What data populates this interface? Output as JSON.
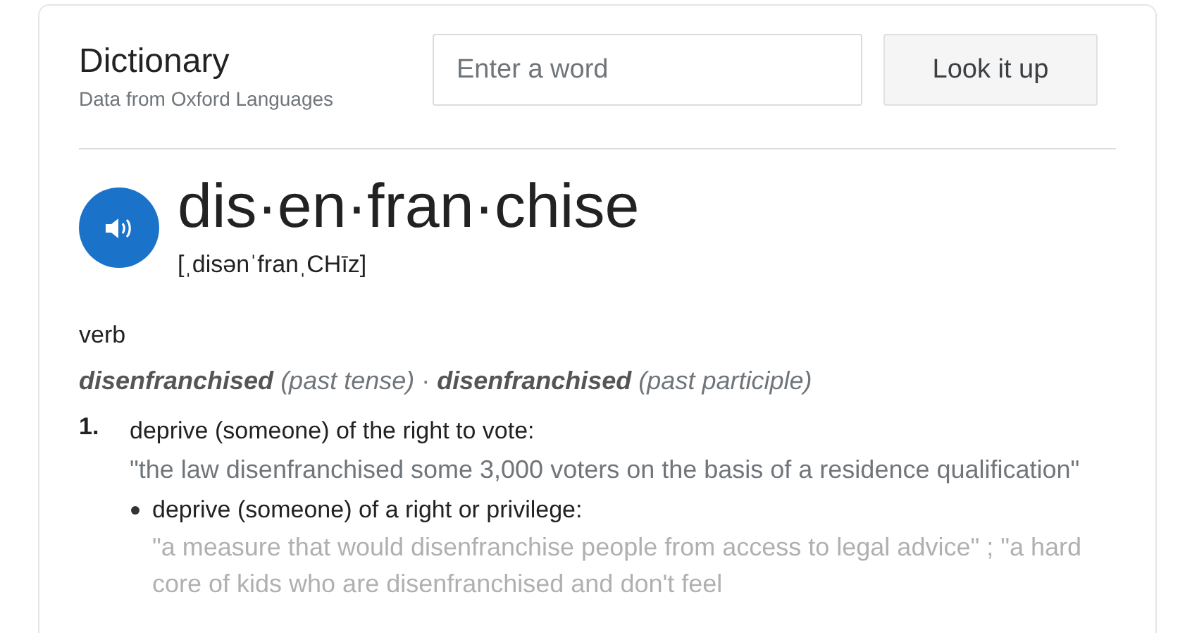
{
  "header": {
    "title": "Dictionary",
    "source": "Data from Oxford Languages"
  },
  "search": {
    "placeholder": "Enter a word",
    "button": "Look it up"
  },
  "entry": {
    "headword": "dis·en·fran·chise",
    "pronunciation": "[ˌdisənˈfranˌCHīz]",
    "part_of_speech": "verb",
    "forms": "**disenfranchised** *(past tense)* · **disenfranchised** *(past participle)*",
    "senses": [
      {
        "number": "1.",
        "definition": "deprive (someone) of the right to vote:",
        "example": "\"the law disenfranchised some 3,000 voters on the basis of a residence qualification\"",
        "subsenses": [
          {
            "definition": "deprive (someone) of a right or privilege:",
            "example": "\"a measure that would disenfranchise people from access to legal advice\" ; \"a hard core of kids who are disenfranchised and don't feel"
          }
        ]
      }
    ]
  }
}
